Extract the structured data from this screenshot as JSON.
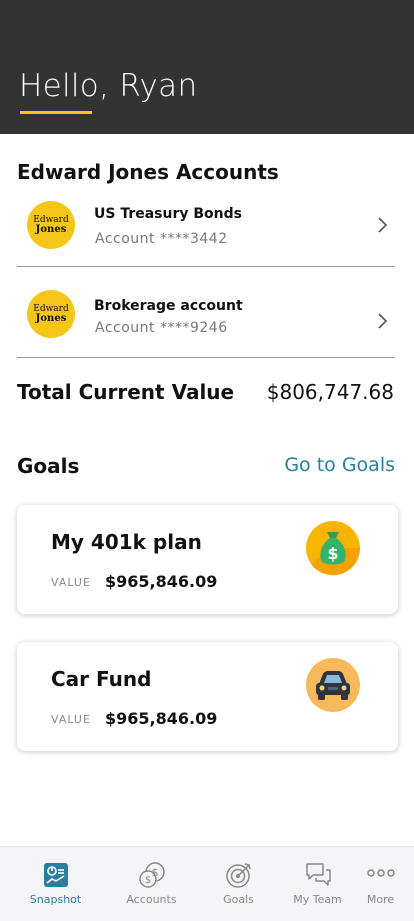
{
  "header": {
    "greeting": "Hello, Ryan"
  },
  "accounts": {
    "title": "Edward Jones Accounts",
    "logo_line1": "Edward",
    "logo_line2": "Jones",
    "items": [
      {
        "name": "US Treasury Bonds",
        "number": "Account ****3442"
      },
      {
        "name": "Brokerage account",
        "number": "Account ****9246"
      }
    ],
    "total_label": "Total Current Value",
    "total_value": "$806,747.68"
  },
  "goals": {
    "title": "Goals",
    "link": "Go to Goals",
    "value_label": "VALUE",
    "items": [
      {
        "name": "My 401k plan",
        "value": "$965,846.09",
        "icon": "money-bag-icon"
      },
      {
        "name": "Car Fund",
        "value": "$965,846.09",
        "icon": "car-icon"
      }
    ]
  },
  "tabbar": {
    "items": [
      {
        "label": "Snapshot",
        "icon": "snapshot-icon",
        "active": true
      },
      {
        "label": "Accounts",
        "icon": "coins-icon",
        "active": false
      },
      {
        "label": "Goals",
        "icon": "target-icon",
        "active": false
      },
      {
        "label": "My Team",
        "icon": "chat-bubbles-icon",
        "active": false
      },
      {
        "label": "More",
        "icon": "more-dots-icon",
        "active": false
      }
    ]
  },
  "colors": {
    "header_bg": "#333333",
    "accent_yellow": "#f5c518",
    "link_blue": "#2a7ea0",
    "tabbar_bg": "#f5f5f7"
  }
}
